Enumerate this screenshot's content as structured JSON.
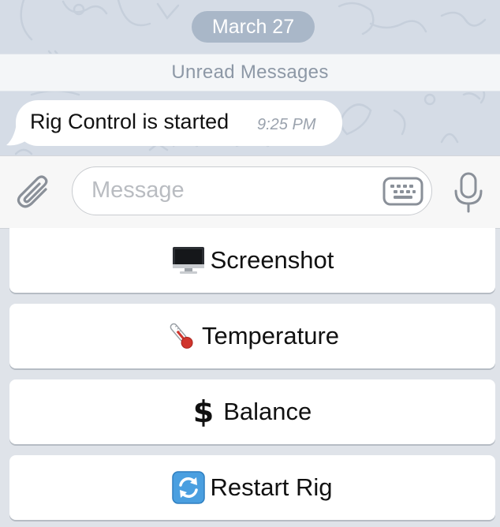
{
  "chat": {
    "date_label": "March 27",
    "unread_label": "Unread Messages",
    "message": {
      "text": "Rig Control is started",
      "time": "9:25 PM"
    }
  },
  "composer": {
    "placeholder": "Message",
    "attach_icon": "paperclip-icon",
    "keyboard_icon": "keyboard-icon",
    "mic_icon": "microphone-icon"
  },
  "reply_keyboard": {
    "buttons": [
      {
        "icon": "desktop-computer-emoji",
        "label": "Screenshot"
      },
      {
        "icon": "thermometer-emoji",
        "label": "Temperature"
      },
      {
        "icon": "heavy-dollar-sign-emoji",
        "label": "Balance"
      },
      {
        "icon": "counterclockwise-arrows-emoji",
        "label": "Restart Rig"
      }
    ]
  },
  "colors": {
    "wallpaper": "#d5dce6",
    "date_pill": "#a9b7c8",
    "unread_bar": "#f4f6f8",
    "bubble": "#ffffff",
    "panel": "#f7f7f7",
    "icon_gray": "#8a9099"
  }
}
